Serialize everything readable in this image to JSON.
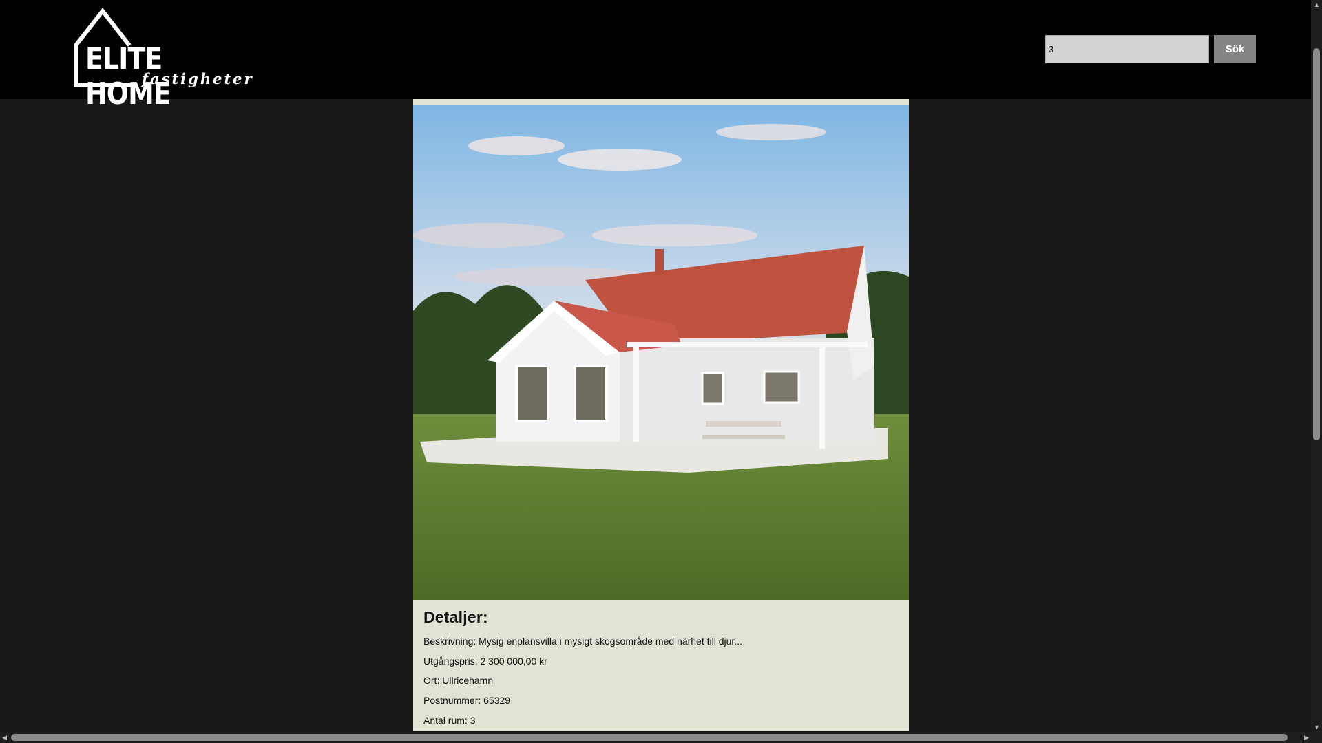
{
  "header": {
    "logo": {
      "title": "ELITE HOME",
      "subtitle": "fastigheter",
      "icon": "house-outline-icon"
    },
    "search": {
      "value": "3",
      "button_label": "Sök"
    }
  },
  "listing": {
    "image": "white-house-with-red-tile-roof-photo",
    "details_heading": "Detaljer:",
    "description": "Beskrivning: Mysig enplansvilla i mysigt skogsområde med närhet till djur...",
    "price": "Utgångspris: 2 300 000,00 kr",
    "city": "Ort: Ullricehamn",
    "postal_code": "Postnummer: 65329",
    "rooms": "Antal rum: 3"
  },
  "colors": {
    "header_bg": "#000000",
    "page_bg": "#171717",
    "card_bg": "#e3e3d5",
    "button_bg": "#858585"
  }
}
